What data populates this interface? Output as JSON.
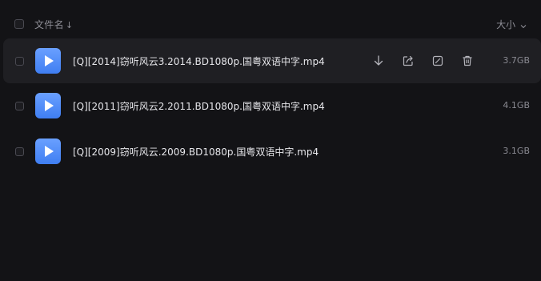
{
  "header": {
    "name_label": "文件名",
    "sort_arrow": "↓",
    "size_label": "大小",
    "size_chevron": "⌄"
  },
  "files": [
    {
      "name": "[Q][2014]窃听风云3.2014.BD1080p.国粤双语中字.mp4",
      "size": "3.7GB",
      "hovered": true
    },
    {
      "name": "[Q][2011]窃听风云2.2011.BD1080p.国粤双语中字.mp4",
      "size": "4.1GB",
      "hovered": false
    },
    {
      "name": "[Q][2009]窃听风云.2009.BD1080p.国粤双语中字.mp4",
      "size": "3.1GB",
      "hovered": false
    }
  ],
  "icons": {
    "file_type": "video-play-icon",
    "download": "download-icon",
    "share": "share-icon",
    "rename": "edit-icon",
    "delete": "trash-icon"
  },
  "colors": {
    "background": "#131316",
    "hover_row": "#1f1f23",
    "file_icon": "#4f8cf8",
    "text_primary": "#e6e6ea",
    "text_secondary": "#8a8a92"
  }
}
